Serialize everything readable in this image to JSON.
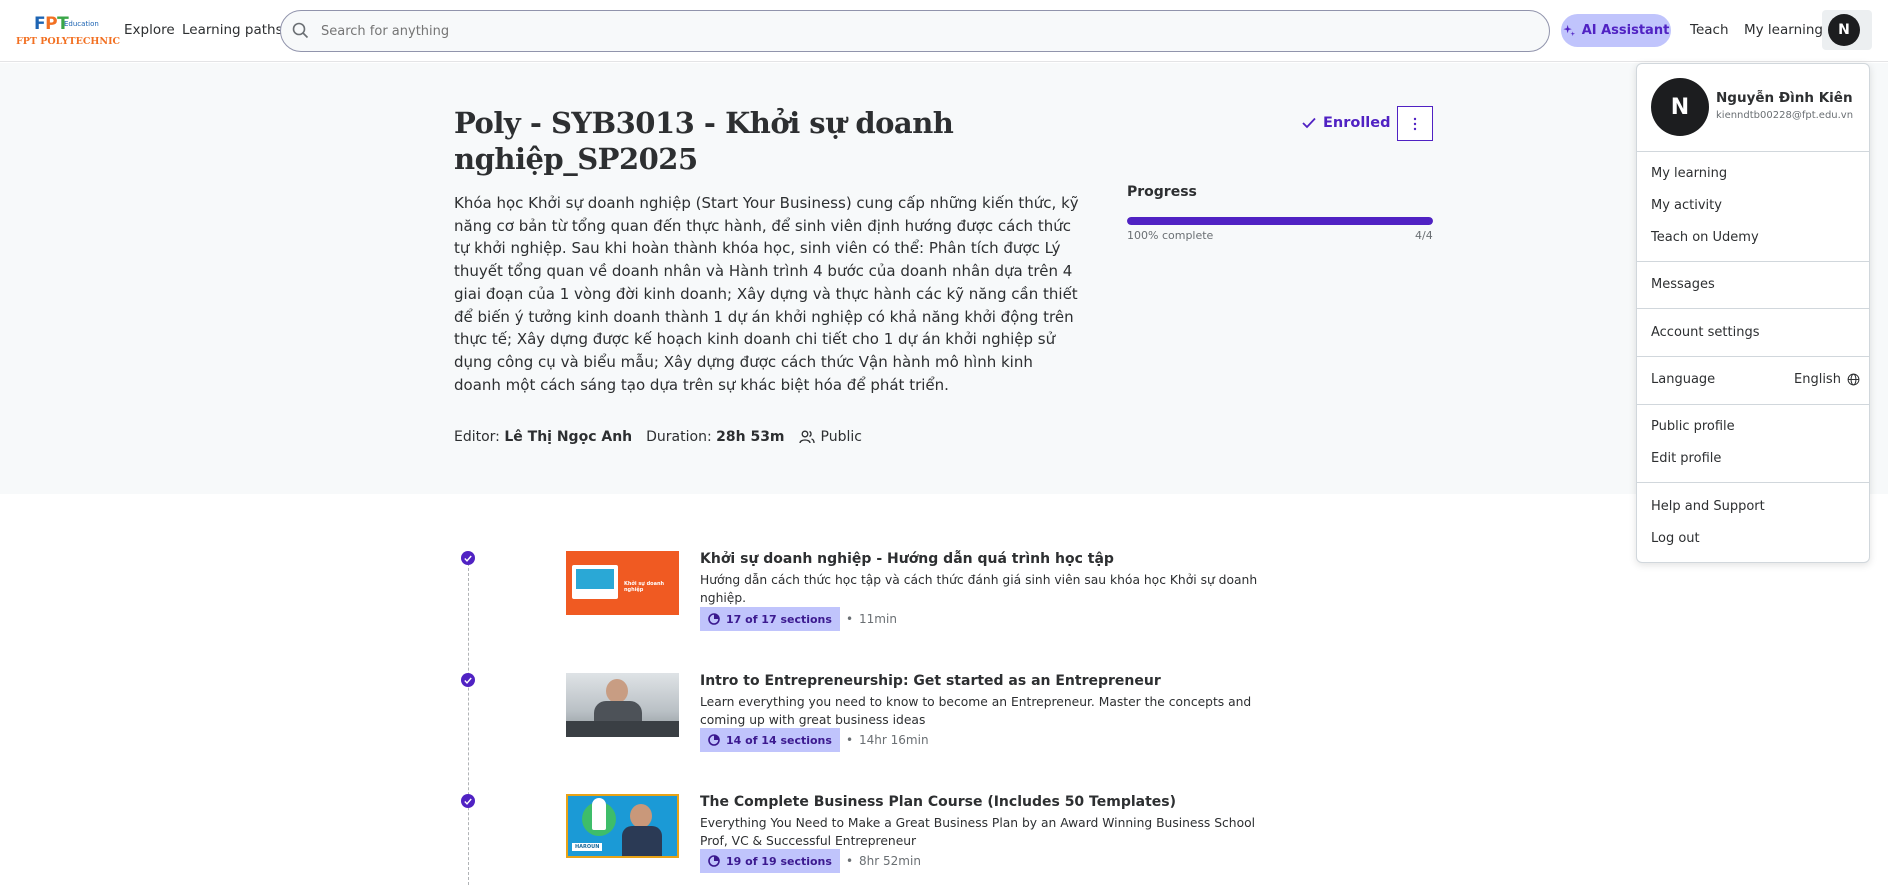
{
  "header": {
    "logo": {
      "top": "FPT",
      "edu": "Education",
      "bottom": "FPT POLYTECHNIC"
    },
    "nav": {
      "explore": "Explore",
      "learning_paths": "Learning paths",
      "teach": "Teach",
      "my_learning": "My learning"
    },
    "search_placeholder": "Search for anything",
    "ai_assistant": "AI Assistant",
    "avatar_initial": "N"
  },
  "course": {
    "title": "Poly - SYB3013 - Khởi sự doanh nghiệp_SP2025",
    "description": "Khóa học Khởi sự doanh nghiệp (Start Your Business) cung cấp những kiến thức, kỹ năng cơ bản từ tổng quan đến thực hành, để sinh viên định hướng được cách thức tự khởi nghiệp. Sau khi hoàn thành khóa học, sinh viên có thể: Phân tích được Lý thuyết tổng quan về doanh nhân và Hành trình 4 bước của doanh nhân dựa trên 4 giai đoạn của 1 vòng đời kinh doanh; Xây dựng và thực hành các kỹ năng cần thiết để biến ý tưởng kinh doanh thành 1 dự án khởi nghiệp có khả năng khởi động trên thực tế; Xây dựng được kế hoạch kinh doanh chi tiết cho 1 dự án khởi nghiệp sử dụng công cụ và biểu mẫu; Xây dựng được cách thức Vận hành mô hình kinh doanh một cách sáng tạo dựa trên sự khác biệt hóa để phát triển.",
    "editor_label": "Editor:",
    "editor": "Lê Thị Ngọc Anh",
    "duration_label": "Duration:",
    "duration": "28h 53m",
    "visibility": "Public",
    "enrolled": "Enrolled",
    "progress": {
      "label": "Progress",
      "complete_text": "100% complete",
      "count": "4/4",
      "fraction": 1.0
    }
  },
  "items": [
    {
      "title": "Khởi sự doanh nghiệp - Hướng dẫn quá trình học tập",
      "description": "Hướng dẫn cách thức học tập và cách thức đánh giá sinh viên sau khóa học Khởi sự doanh nghiệp.",
      "sections": "17 of 17 sections",
      "duration": "11min",
      "thumb_text": "Khởi sự doanh nghiệp"
    },
    {
      "title": "Intro to Entrepreneurship: Get started as an Entrepreneur",
      "description": "Learn everything you need to know to become an Entrepreneur. Master the concepts and coming up with great business ideas",
      "sections": "14 of 14 sections",
      "duration": "14hr 16min"
    },
    {
      "title": "The Complete Business Plan Course (Includes 50 Templates)",
      "description": "Everything You Need to Make a Great Business Plan by an Award Winning Business School Prof, VC & Successful Entrepreneur",
      "sections": "19 of 19 sections",
      "duration": "8hr 52min",
      "thumb_text": "HAROUN"
    }
  ],
  "dropdown": {
    "initial": "N",
    "name": "Nguyễn Đình Kiên",
    "email": "kienndtb00228@fpt.edu.vn",
    "my_learning": "My learning",
    "my_activity": "My activity",
    "teach": "Teach on Udemy",
    "messages": "Messages",
    "account_settings": "Account settings",
    "language": "Language",
    "language_value": "English",
    "public_profile": "Public profile",
    "edit_profile": "Edit profile",
    "help": "Help and Support",
    "logout": "Log out"
  }
}
